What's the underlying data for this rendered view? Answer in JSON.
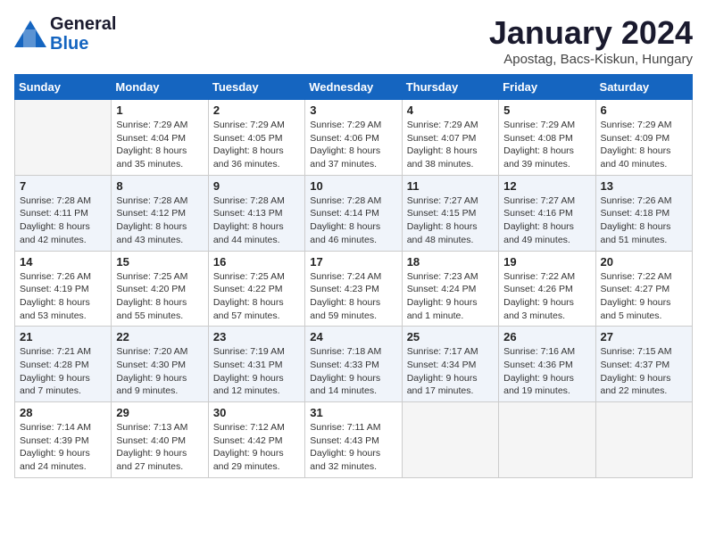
{
  "logo": {
    "line1": "General",
    "line2": "Blue"
  },
  "title": "January 2024",
  "location": "Apostag, Bacs-Kiskun, Hungary",
  "days_of_week": [
    "Sunday",
    "Monday",
    "Tuesday",
    "Wednesday",
    "Thursday",
    "Friday",
    "Saturday"
  ],
  "weeks": [
    [
      {
        "day": "",
        "empty": true
      },
      {
        "day": "1",
        "sunrise": "7:29 AM",
        "sunset": "4:04 PM",
        "daylight": "8 hours and 35 minutes."
      },
      {
        "day": "2",
        "sunrise": "7:29 AM",
        "sunset": "4:05 PM",
        "daylight": "8 hours and 36 minutes."
      },
      {
        "day": "3",
        "sunrise": "7:29 AM",
        "sunset": "4:06 PM",
        "daylight": "8 hours and 37 minutes."
      },
      {
        "day": "4",
        "sunrise": "7:29 AM",
        "sunset": "4:07 PM",
        "daylight": "8 hours and 38 minutes."
      },
      {
        "day": "5",
        "sunrise": "7:29 AM",
        "sunset": "4:08 PM",
        "daylight": "8 hours and 39 minutes."
      },
      {
        "day": "6",
        "sunrise": "7:29 AM",
        "sunset": "4:09 PM",
        "daylight": "8 hours and 40 minutes."
      }
    ],
    [
      {
        "day": "7",
        "sunrise": "7:28 AM",
        "sunset": "4:11 PM",
        "daylight": "8 hours and 42 minutes."
      },
      {
        "day": "8",
        "sunrise": "7:28 AM",
        "sunset": "4:12 PM",
        "daylight": "8 hours and 43 minutes."
      },
      {
        "day": "9",
        "sunrise": "7:28 AM",
        "sunset": "4:13 PM",
        "daylight": "8 hours and 44 minutes."
      },
      {
        "day": "10",
        "sunrise": "7:28 AM",
        "sunset": "4:14 PM",
        "daylight": "8 hours and 46 minutes."
      },
      {
        "day": "11",
        "sunrise": "7:27 AM",
        "sunset": "4:15 PM",
        "daylight": "8 hours and 48 minutes."
      },
      {
        "day": "12",
        "sunrise": "7:27 AM",
        "sunset": "4:16 PM",
        "daylight": "8 hours and 49 minutes."
      },
      {
        "day": "13",
        "sunrise": "7:26 AM",
        "sunset": "4:18 PM",
        "daylight": "8 hours and 51 minutes."
      }
    ],
    [
      {
        "day": "14",
        "sunrise": "7:26 AM",
        "sunset": "4:19 PM",
        "daylight": "8 hours and 53 minutes."
      },
      {
        "day": "15",
        "sunrise": "7:25 AM",
        "sunset": "4:20 PM",
        "daylight": "8 hours and 55 minutes."
      },
      {
        "day": "16",
        "sunrise": "7:25 AM",
        "sunset": "4:22 PM",
        "daylight": "8 hours and 57 minutes."
      },
      {
        "day": "17",
        "sunrise": "7:24 AM",
        "sunset": "4:23 PM",
        "daylight": "8 hours and 59 minutes."
      },
      {
        "day": "18",
        "sunrise": "7:23 AM",
        "sunset": "4:24 PM",
        "daylight": "9 hours and 1 minute."
      },
      {
        "day": "19",
        "sunrise": "7:22 AM",
        "sunset": "4:26 PM",
        "daylight": "9 hours and 3 minutes."
      },
      {
        "day": "20",
        "sunrise": "7:22 AM",
        "sunset": "4:27 PM",
        "daylight": "9 hours and 5 minutes."
      }
    ],
    [
      {
        "day": "21",
        "sunrise": "7:21 AM",
        "sunset": "4:28 PM",
        "daylight": "9 hours and 7 minutes."
      },
      {
        "day": "22",
        "sunrise": "7:20 AM",
        "sunset": "4:30 PM",
        "daylight": "9 hours and 9 minutes."
      },
      {
        "day": "23",
        "sunrise": "7:19 AM",
        "sunset": "4:31 PM",
        "daylight": "9 hours and 12 minutes."
      },
      {
        "day": "24",
        "sunrise": "7:18 AM",
        "sunset": "4:33 PM",
        "daylight": "9 hours and 14 minutes."
      },
      {
        "day": "25",
        "sunrise": "7:17 AM",
        "sunset": "4:34 PM",
        "daylight": "9 hours and 17 minutes."
      },
      {
        "day": "26",
        "sunrise": "7:16 AM",
        "sunset": "4:36 PM",
        "daylight": "9 hours and 19 minutes."
      },
      {
        "day": "27",
        "sunrise": "7:15 AM",
        "sunset": "4:37 PM",
        "daylight": "9 hours and 22 minutes."
      }
    ],
    [
      {
        "day": "28",
        "sunrise": "7:14 AM",
        "sunset": "4:39 PM",
        "daylight": "9 hours and 24 minutes."
      },
      {
        "day": "29",
        "sunrise": "7:13 AM",
        "sunset": "4:40 PM",
        "daylight": "9 hours and 27 minutes."
      },
      {
        "day": "30",
        "sunrise": "7:12 AM",
        "sunset": "4:42 PM",
        "daylight": "9 hours and 29 minutes."
      },
      {
        "day": "31",
        "sunrise": "7:11 AM",
        "sunset": "4:43 PM",
        "daylight": "9 hours and 32 minutes."
      },
      {
        "day": "",
        "empty": true
      },
      {
        "day": "",
        "empty": true
      },
      {
        "day": "",
        "empty": true
      }
    ]
  ],
  "labels": {
    "sunrise": "Sunrise:",
    "sunset": "Sunset:",
    "daylight": "Daylight:"
  }
}
